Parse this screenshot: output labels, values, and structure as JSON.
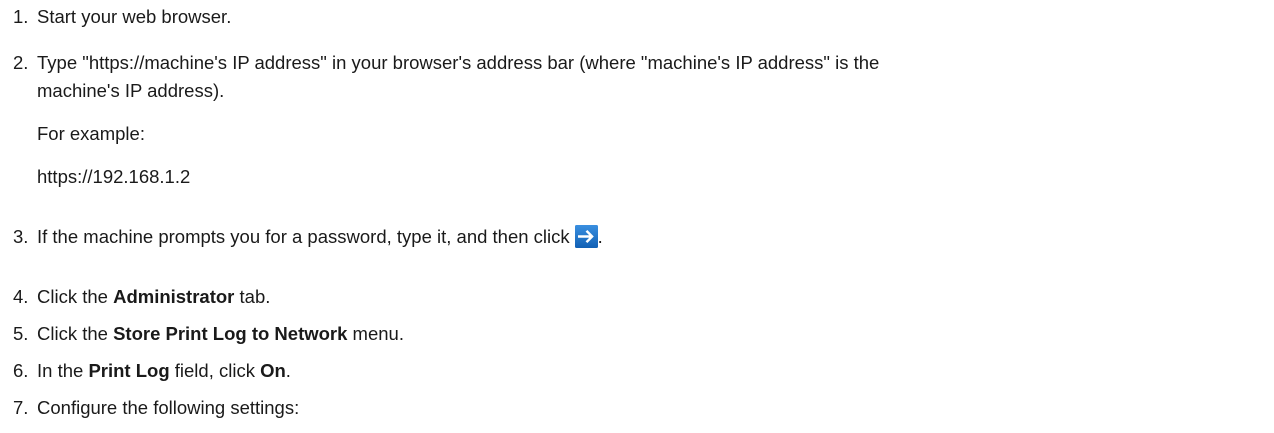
{
  "steps": [
    {
      "number": "1.",
      "text": "Start your web browser."
    },
    {
      "number": "2.",
      "line1": "Type \"https://machine's IP address\" in your browser's address bar (where \"machine's IP address\" is the",
      "line2": "machine's IP address).",
      "example_label": "For example:",
      "example_value": "https://192.168.1.2"
    },
    {
      "number": "3.",
      "text": "If the machine prompts you for a password, type it, and then click",
      "trailing": ".",
      "icon": "arrow-right-icon"
    },
    {
      "number": "4.",
      "before": "Click the ",
      "bold": "Administrator",
      "after": " tab."
    },
    {
      "number": "5.",
      "before": "Click the ",
      "bold": "Store Print Log to Network",
      "after": " menu."
    },
    {
      "number": "6.",
      "before": "In the ",
      "bold": "Print Log",
      "middle": " field, click ",
      "bold2": "On",
      "after": "."
    },
    {
      "number": "7.",
      "text": "Configure the following settings:"
    }
  ],
  "colors": {
    "text": "#1a1a1a",
    "icon_background": "#1a73c8",
    "icon_arrow": "#ffffff"
  }
}
